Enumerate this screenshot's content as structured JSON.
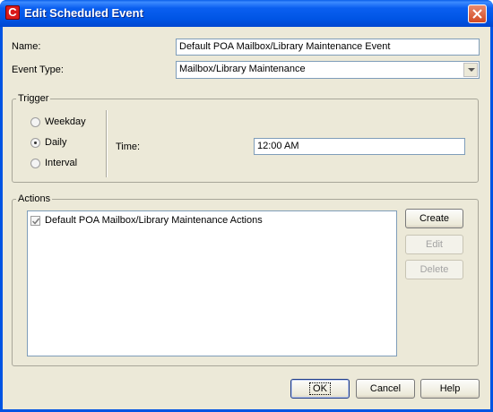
{
  "window": {
    "title": "Edit Scheduled Event"
  },
  "form": {
    "name_label": "Name:",
    "name_value": "Default POA Mailbox/Library Maintenance Event",
    "event_type_label": "Event Type:",
    "event_type_value": "Mailbox/Library Maintenance"
  },
  "trigger": {
    "legend": "Trigger",
    "options": [
      {
        "label": "Weekday",
        "checked": false
      },
      {
        "label": "Daily",
        "checked": true
      },
      {
        "label": "Interval",
        "checked": false
      }
    ],
    "time_label": "Time:",
    "time_value": "12:00 AM"
  },
  "actions": {
    "legend": "Actions",
    "items": [
      {
        "label": "Default POA Mailbox/Library Maintenance Actions",
        "checked": true
      }
    ],
    "create_label": "Create",
    "edit_label": "Edit",
    "delete_label": "Delete"
  },
  "footer": {
    "ok_label": "OK",
    "cancel_label": "Cancel",
    "help_label": "Help"
  },
  "icons": {
    "app": "groupwise-app-icon",
    "close": "close-icon",
    "dropdown": "chevron-down-icon",
    "checkmark": "checkmark-icon"
  }
}
